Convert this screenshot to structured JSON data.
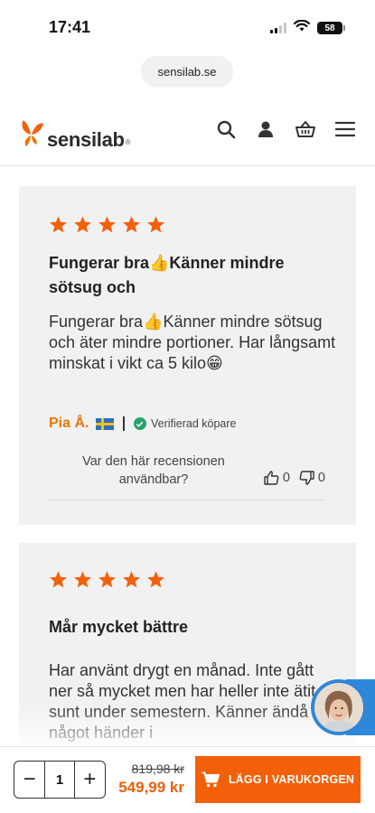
{
  "status_bar": {
    "time": "17:41",
    "battery": "58"
  },
  "browser": {
    "url": "sensilab.se"
  },
  "header": {
    "logo_text": "sensilab",
    "logo_reg": "®"
  },
  "reviews": [
    {
      "rating": 5,
      "title": "Fungerar bra👍Känner mindre sötsug och",
      "body": "Fungerar bra👍Känner mindre sötsug och äter mindre portioner. Har långsamt minskat i vikt ca 5 kilo😁",
      "reviewer": "Pia Å.",
      "verified_label": "Verifierad köpare",
      "helpful_question": "Var den här recensionen användbar?",
      "thumbs_up": "0",
      "thumbs_down": "0"
    },
    {
      "rating": 5,
      "title": "Mår mycket bättre",
      "body": "Har använt drygt en månad. Inte gått ner så mycket men har heller inte ätit så sunt under semestern. Känner ändå att något händer i"
    }
  ],
  "cart_bar": {
    "quantity": "1",
    "minus_label": "−",
    "plus_label": "+",
    "old_price": "819,98 kr",
    "new_price": "549,99 kr",
    "add_to_cart_label": "LÄGG I VARUKORGEN"
  },
  "colors": {
    "accent": "#f2600a",
    "star": "#f2600a",
    "reviewer_name": "#e8760a",
    "verified": "#27a36b",
    "chat": "#2e87d9"
  }
}
